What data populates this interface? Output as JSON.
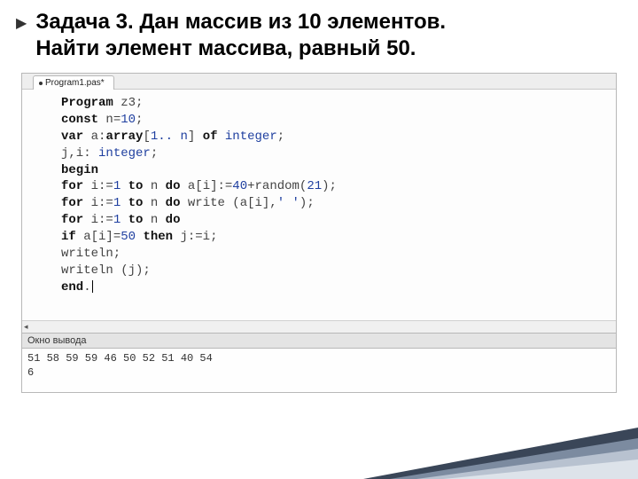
{
  "title_line1": "Задача 3. Дан массив из 10 элементов.",
  "title_line2": "Найти элемент массива, равный 50.",
  "tab_name": "Program1.pas*",
  "code": {
    "l1a": "Program",
    "l1b": " z3;",
    "l2a": "const",
    "l2b": " n=",
    "l2c": "10",
    "l2d": ";",
    "l3a": "var",
    "l3b": " a:",
    "l3c": "array",
    "l3d": "[",
    "l3e": "1.. n",
    "l3f": "] ",
    "l3g": "of",
    "l3h": "  ",
    "l3i": "integer",
    "l3j": ";",
    "l4a": "    j,i: ",
    "l4b": "integer",
    "l4c": ";",
    "l5a": "begin",
    "l6a": "  ",
    "l6b": "for",
    "l6c": " i:=",
    "l6d": "1",
    "l6e": " ",
    "l6f": "to",
    "l6g": " n ",
    "l6h": "do",
    "l6i": " a[i]:=",
    "l6j": "40",
    "l6k": "+random(",
    "l6l": "21",
    "l6m": ");",
    "l7a": "  ",
    "l7b": "for",
    "l7c": " i:=",
    "l7d": "1",
    "l7e": " ",
    "l7f": "to",
    "l7g": " n ",
    "l7h": "do",
    "l7i": " write (a[i],",
    "l7j": "' '",
    "l7k": ");",
    "l8a": "  ",
    "l8b": "for",
    "l8c": " i:=",
    "l8d": "1",
    "l8e": " ",
    "l8f": "to",
    "l8g": " n ",
    "l8h": "do",
    "l9a": "  ",
    "l9b": "if",
    "l9c": " a[i]=",
    "l9d": "50",
    "l9e": " ",
    "l9f": "then",
    "l9g": " j:=i;",
    "l10a": "  writeln;",
    "l11a": "  writeln (j);",
    "l12a": "end",
    "l12b": "."
  },
  "output_label": "Окно вывода",
  "output_line1": "51 58 59 59 46 50 52 51 40 54",
  "output_line2": "6"
}
